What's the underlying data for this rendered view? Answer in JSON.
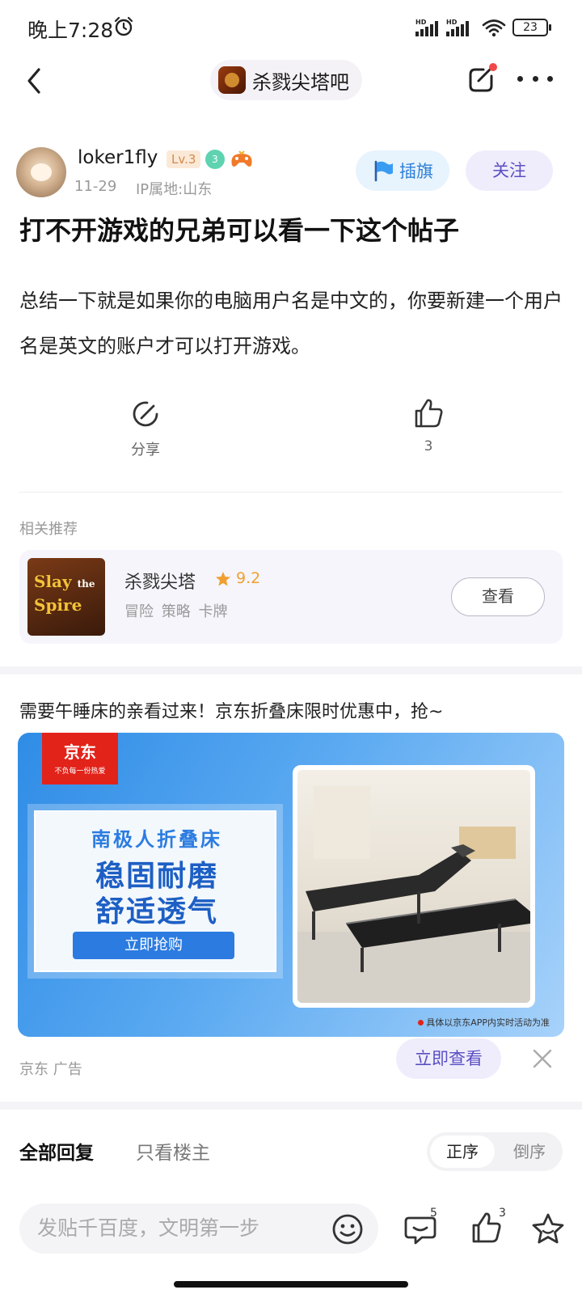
{
  "status_bar": {
    "time": "晚上7:28",
    "battery": "23",
    "signal_label": "HD"
  },
  "nav": {
    "forum_name": "杀戮尖塔吧"
  },
  "author": {
    "name": "loker1fly",
    "level": "Lv.3",
    "badge_number": "3",
    "date": "11-29",
    "ip_location": "IP属地:山东",
    "flag_label": "插旗",
    "follow_label": "关注"
  },
  "post": {
    "title": "打不开游戏的兄弟可以看一下这个帖子",
    "body": "总结一下就是如果你的电脑用户名是中文的，你要新建一个用户名是英文的账户才可以打开游戏。",
    "share_label": "分享",
    "like_count": "3"
  },
  "related": {
    "section_title": "相关推荐",
    "game_name": "杀戮尖塔",
    "rating": "9.2",
    "tags": "冒险 策略 卡牌",
    "view_label": "查看",
    "cover_line1": "Slay",
    "cover_line2": "the",
    "cover_line3": "Spire"
  },
  "ad": {
    "caption": "需要午睡床的亲看过来！京东折叠床限时优惠中，抢~",
    "logo_text": "京东",
    "logo_sub": "不负每一份热爱",
    "headline1": "南极人折叠床",
    "headline2": "稳固耐磨",
    "headline3": "舒适透气",
    "buy_label": "立即抢购",
    "disclaimer": "具体以京东APP内实时活动为准",
    "source": "京东  广告",
    "cta_label": "立即查看"
  },
  "replies": {
    "tab_all": "全部回复",
    "tab_op": "只看楼主",
    "sort_asc": "正序",
    "sort_desc": "倒序"
  },
  "bottom_bar": {
    "input_placeholder": "发贴千百度，文明第一步",
    "comments_count": "5",
    "likes_count": "3"
  },
  "colors": {
    "accent_purple": "#5b4fc4",
    "flag_blue": "#2f7fd6",
    "rating_orange": "#f0a030",
    "jd_red": "#e2231a"
  },
  "icons": [
    "back-icon",
    "edit-icon",
    "more-icon",
    "share-icon",
    "like-icon",
    "star-icon",
    "close-icon",
    "emoji-icon",
    "comments-icon",
    "favorite-star-icon",
    "flag-icon",
    "gamepad-icon",
    "alarm-icon",
    "wifi-icon"
  ]
}
